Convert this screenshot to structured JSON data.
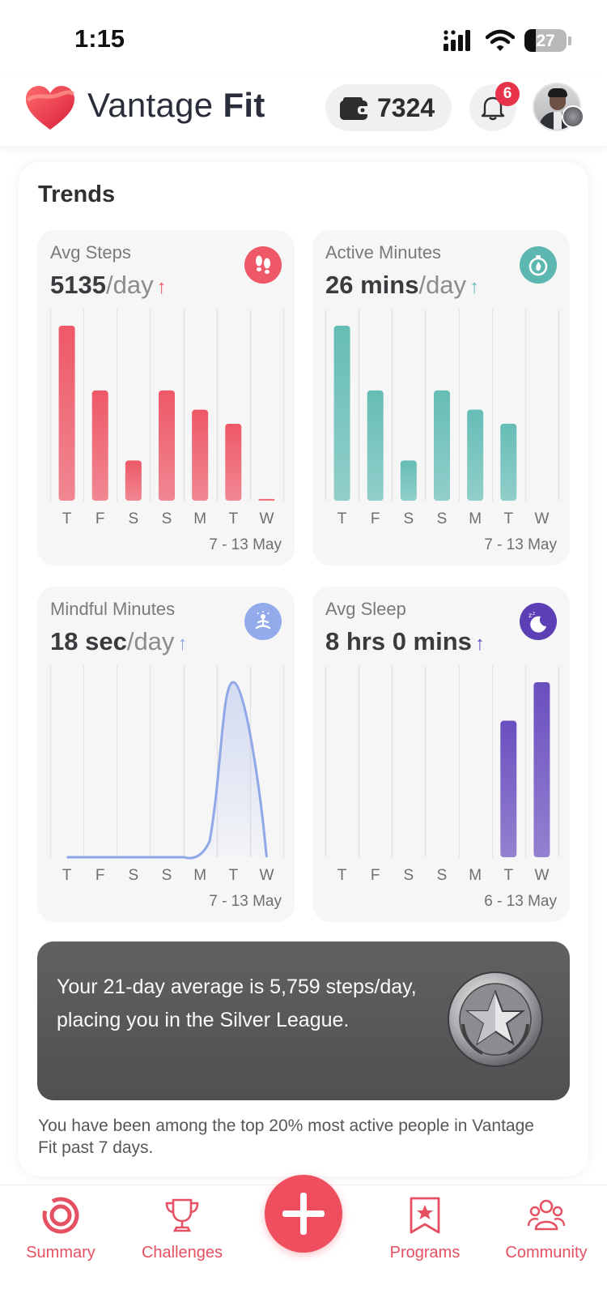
{
  "status_bar": {
    "time": "1:15",
    "battery": "27"
  },
  "header": {
    "brand_light": "Vantage ",
    "brand_bold": "Fit",
    "coins": "7324",
    "notification_count": "6"
  },
  "trends": {
    "title": "Trends",
    "tiles": [
      {
        "title": "Avg Steps",
        "value": "5135",
        "unit": "/day",
        "arrow": "↑",
        "dates": "7 - 13 May",
        "color": "#ee5867",
        "chart_data": {
          "type": "bar",
          "categories": [
            "T",
            "F",
            "S",
            "S",
            "M",
            "T",
            "W"
          ],
          "values": [
            1.0,
            0.63,
            0.23,
            0.63,
            0.52,
            0.44,
            0.01
          ]
        }
      },
      {
        "title": "Active Minutes",
        "value": "26 mins",
        "unit": "/day",
        "arrow": "↑",
        "dates": "7 - 13 May",
        "color": "#66bdb6",
        "chart_data": {
          "type": "bar",
          "categories": [
            "T",
            "F",
            "S",
            "S",
            "M",
            "T",
            "W"
          ],
          "values": [
            1.0,
            0.63,
            0.23,
            0.63,
            0.52,
            0.44,
            0
          ]
        }
      },
      {
        "title": "Mindful Minutes",
        "value": "18 sec",
        "unit": "/day",
        "arrow": "↑",
        "dates": "7 - 13 May",
        "color": "#90a8e8",
        "chart_data": {
          "type": "area",
          "categories": [
            "T",
            "F",
            "S",
            "S",
            "M",
            "T",
            "W"
          ],
          "values": [
            0,
            0,
            0,
            0,
            0,
            1.0,
            0
          ]
        }
      },
      {
        "title": "Avg Sleep",
        "value": "8 hrs 0 mins",
        "unit": "",
        "arrow": "↑",
        "dates": "6 - 13 May",
        "color": "#6a4fbf",
        "chart_data": {
          "type": "bar",
          "categories": [
            "T",
            "F",
            "S",
            "S",
            "M",
            "T",
            "W"
          ],
          "values": [
            0,
            0,
            0,
            0,
            0,
            0.78,
            1.0
          ]
        }
      }
    ]
  },
  "league_banner": {
    "text": "Your 21-day average is 5,759 steps/day, placing you in the Silver League."
  },
  "footnote": "You have been among the top 20% most active people in Vantage Fit past 7 days.",
  "nav": {
    "summary": "Summary",
    "challenges": "Challenges",
    "programs": "Programs",
    "community": "Community"
  },
  "colors": {
    "accent": "#ee4e5d",
    "banner": "#585859"
  }
}
